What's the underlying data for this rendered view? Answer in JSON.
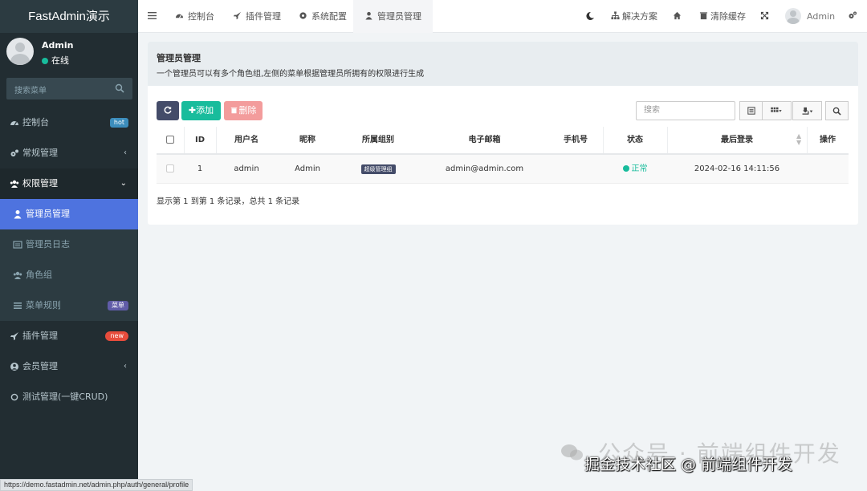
{
  "app": {
    "title": "FastAdmin演示"
  },
  "user": {
    "name": "Admin",
    "status": "在线"
  },
  "sidebar": {
    "search_placeholder": "搜索菜单",
    "items": [
      {
        "label": "控制台",
        "icon": "dashboard-icon",
        "badge": "hot"
      },
      {
        "label": "常规管理",
        "icon": "cogs-icon",
        "arrow": "‹"
      },
      {
        "label": "权限管理",
        "icon": "group-icon",
        "arrow": "⌄"
      },
      {
        "label": "管理员管理",
        "icon": "user-icon"
      },
      {
        "label": "管理员日志",
        "icon": "list-alt-icon"
      },
      {
        "label": "角色组",
        "icon": "group-icon"
      },
      {
        "label": "菜单规则",
        "icon": "bars-icon",
        "badge": "菜单"
      },
      {
        "label": "插件管理",
        "icon": "rocket-icon",
        "badge": "new"
      },
      {
        "label": "会员管理",
        "icon": "user-circle-icon",
        "arrow": "‹"
      },
      {
        "label": "测试管理(一键CRUD)",
        "icon": "circle-o-icon"
      }
    ]
  },
  "topnav": {
    "tabs": [
      {
        "label": "控制台",
        "icon": "dashboard-icon"
      },
      {
        "label": "插件管理",
        "icon": "rocket-icon"
      },
      {
        "label": "系统配置",
        "icon": "gear-icon"
      },
      {
        "label": "管理员管理",
        "icon": "user-icon",
        "active": true
      }
    ],
    "right": {
      "solutions": "解决方案",
      "clear_cache": "清除缓存",
      "user": "Admin"
    }
  },
  "panel": {
    "title": "管理员管理",
    "description": "一个管理员可以有多个角色组,左侧的菜单根据管理员所拥有的权限进行生成"
  },
  "toolbar": {
    "add_label": "添加",
    "delete_label": "删除",
    "search_placeholder": "搜索"
  },
  "table": {
    "columns": [
      "ID",
      "用户名",
      "昵称",
      "所属组别",
      "电子邮箱",
      "手机号",
      "状态",
      "最后登录",
      "操作"
    ],
    "rows": [
      {
        "id": "1",
        "username": "admin",
        "nickname": "Admin",
        "group": "超级管理组",
        "email": "admin@admin.com",
        "mobile": "",
        "status": "正常",
        "last_login": "2024-02-16 14:11:56",
        "actions": ""
      }
    ]
  },
  "pagination": {
    "info": "显示第 1 到第 1 条记录，总共 1 条记录"
  },
  "statusbar": {
    "url": "https://demo.fastadmin.net/admin.php/auth/general/profile"
  },
  "watermark": {
    "text": "公众号 · 前端组件开发",
    "credit": "掘金技术社区 @ 前端组件开发"
  },
  "colors": {
    "sidebar_bg": "#222d32",
    "active": "#4e73df",
    "success": "#18bc9c",
    "danger": "#f39c9c",
    "primary_dark": "#444c69"
  }
}
